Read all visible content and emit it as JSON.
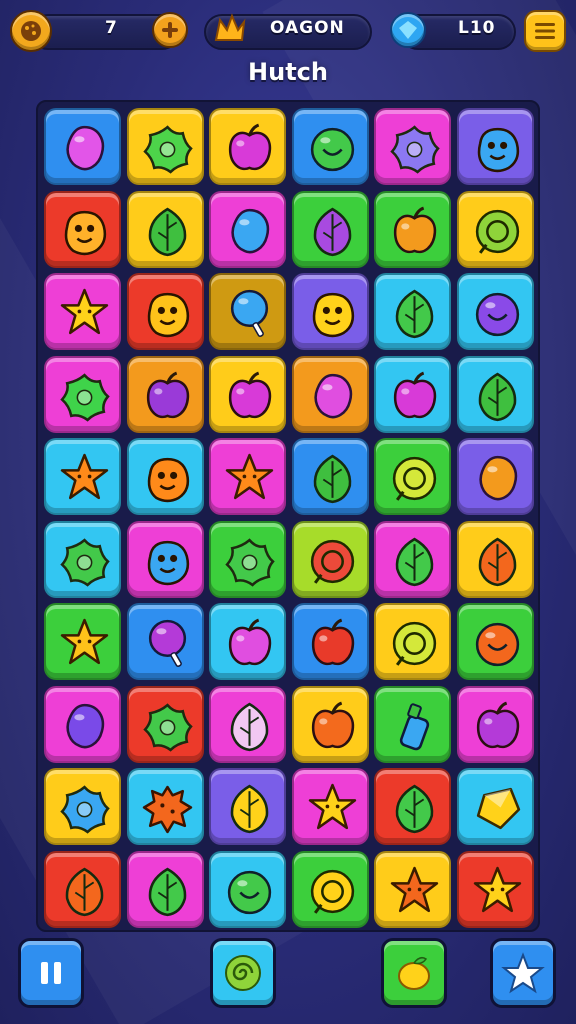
{
  "hud": {
    "left_counter": "7",
    "center_label": "OAGON",
    "right_counter": "L10"
  },
  "title": "Hutch",
  "colors": {
    "blue": "#2f8ff0",
    "yellow": "#ffcc1a",
    "magenta": "#ee3fd6",
    "green": "#3ccf3c",
    "purple": "#7a5ee8",
    "red": "#ec3a2a",
    "cyan": "#33c6f2",
    "orange": "#f39a1d",
    "brown": "#cf9a12",
    "lime": "#a7dc2a"
  },
  "board": {
    "rows": [
      [
        {
          "c": "blue",
          "i": "blob",
          "f": "#e255e8"
        },
        {
          "c": "yellow",
          "i": "flower",
          "f": "#4dd44a"
        },
        {
          "c": "yellow",
          "i": "apple",
          "f": "#d83ad8"
        },
        {
          "c": "blue",
          "i": "round",
          "f": "#43c94a"
        },
        {
          "c": "magenta",
          "i": "flower",
          "f": "#8c78f2"
        },
        {
          "c": "purple",
          "i": "critter",
          "f": "#3aa7f2"
        }
      ],
      [
        {
          "c": "red",
          "i": "critter",
          "f": "#ffb12a"
        },
        {
          "c": "yellow",
          "i": "leaf",
          "f": "#3fbf3f"
        },
        {
          "c": "magenta",
          "i": "blob",
          "f": "#3aa7f2"
        },
        {
          "c": "green",
          "i": "leaf",
          "f": "#a84ae0"
        },
        {
          "c": "green",
          "i": "apple",
          "f": "#f39a1d"
        },
        {
          "c": "yellow",
          "i": "ring",
          "f": "#8fd43a"
        }
      ],
      [
        {
          "c": "magenta",
          "i": "star",
          "f": "#ffd21a"
        },
        {
          "c": "red",
          "i": "critter",
          "f": "#ffc21a"
        },
        {
          "c": "brown",
          "i": "lolli",
          "f": "#3aa7f2"
        },
        {
          "c": "purple",
          "i": "critter",
          "f": "#ffd21a"
        },
        {
          "c": "cyan",
          "i": "leaf",
          "f": "#43c94a"
        },
        {
          "c": "cyan",
          "i": "round",
          "f": "#8a4ae8"
        }
      ],
      [
        {
          "c": "magenta",
          "i": "flower",
          "f": "#3fd34a"
        },
        {
          "c": "orange",
          "i": "apple",
          "f": "#9a3ad8"
        },
        {
          "c": "yellow",
          "i": "apple",
          "f": "#d83ad8"
        },
        {
          "c": "orange",
          "i": "blob",
          "f": "#e04ee0"
        },
        {
          "c": "cyan",
          "i": "apple",
          "f": "#d83ad8"
        },
        {
          "c": "cyan",
          "i": "leaf",
          "f": "#3fbf3f"
        }
      ],
      [
        {
          "c": "cyan",
          "i": "star",
          "f": "#ff8a1a"
        },
        {
          "c": "cyan",
          "i": "critter",
          "f": "#ff8a1a"
        },
        {
          "c": "magenta",
          "i": "star",
          "f": "#ff8a1a"
        },
        {
          "c": "blue",
          "i": "leaf",
          "f": "#3fbf3f"
        },
        {
          "c": "green",
          "i": "ring",
          "f": "#d4e83a"
        },
        {
          "c": "purple",
          "i": "blob",
          "f": "#f39a1d"
        }
      ],
      [
        {
          "c": "cyan",
          "i": "flower",
          "f": "#43c94a"
        },
        {
          "c": "magenta",
          "i": "critter",
          "f": "#3aa7f2"
        },
        {
          "c": "green",
          "i": "flower",
          "f": "#43c94a"
        },
        {
          "c": "lime",
          "i": "ring",
          "f": "#ec4a3a"
        },
        {
          "c": "magenta",
          "i": "leaf",
          "f": "#43c94a"
        },
        {
          "c": "yellow",
          "i": "leaf",
          "f": "#f3671d"
        }
      ],
      [
        {
          "c": "green",
          "i": "star",
          "f": "#ffc21a"
        },
        {
          "c": "blue",
          "i": "lolli",
          "f": "#b43ad8"
        },
        {
          "c": "cyan",
          "i": "apple",
          "f": "#e04ee0"
        },
        {
          "c": "blue",
          "i": "apple",
          "f": "#e83a2a"
        },
        {
          "c": "yellow",
          "i": "ring",
          "f": "#d4e83a"
        },
        {
          "c": "green",
          "i": "round",
          "f": "#f3671d"
        }
      ],
      [
        {
          "c": "magenta",
          "i": "blob",
          "f": "#7a4ae8"
        },
        {
          "c": "red",
          "i": "flower",
          "f": "#43c94a"
        },
        {
          "c": "magenta",
          "i": "leaf",
          "f": "#f2c8f2"
        },
        {
          "c": "yellow",
          "i": "apple",
          "f": "#f36a1d"
        },
        {
          "c": "green",
          "i": "bottle",
          "f": "#3aa7f2"
        },
        {
          "c": "magenta",
          "i": "apple",
          "f": "#b43ad8"
        }
      ],
      [
        {
          "c": "yellow",
          "i": "flower",
          "f": "#3aa7f2"
        },
        {
          "c": "cyan",
          "i": "splat",
          "f": "#f3671d"
        },
        {
          "c": "purple",
          "i": "leaf",
          "f": "#ffd21a"
        },
        {
          "c": "magenta",
          "i": "star",
          "f": "#ffd21a"
        },
        {
          "c": "red",
          "i": "leaf",
          "f": "#43c94a"
        },
        {
          "c": "cyan",
          "i": "gem",
          "f": "#ffd21a"
        }
      ],
      [
        {
          "c": "red",
          "i": "leaf",
          "f": "#f3671d"
        },
        {
          "c": "magenta",
          "i": "leaf",
          "f": "#43c94a"
        },
        {
          "c": "cyan",
          "i": "round",
          "f": "#43c94a"
        },
        {
          "c": "green",
          "i": "ring",
          "f": "#ffd21a"
        },
        {
          "c": "yellow",
          "i": "star",
          "f": "#f3671d"
        },
        {
          "c": "red",
          "i": "star",
          "f": "#ffd21a"
        }
      ]
    ]
  },
  "bottom_bar": {
    "buttons": [
      {
        "name": "pause-button",
        "icon": "pause-icon",
        "color": "#2f8ff0"
      },
      {
        "name": "swirl-booster-button",
        "icon": "swirl-candy-icon",
        "color": "#33c6f2"
      },
      {
        "name": "fruit-booster-button",
        "icon": "lemon-icon",
        "color": "#3ccf3c"
      },
      {
        "name": "star-button",
        "icon": "star-icon",
        "color": "#2f8ff0"
      }
    ]
  }
}
